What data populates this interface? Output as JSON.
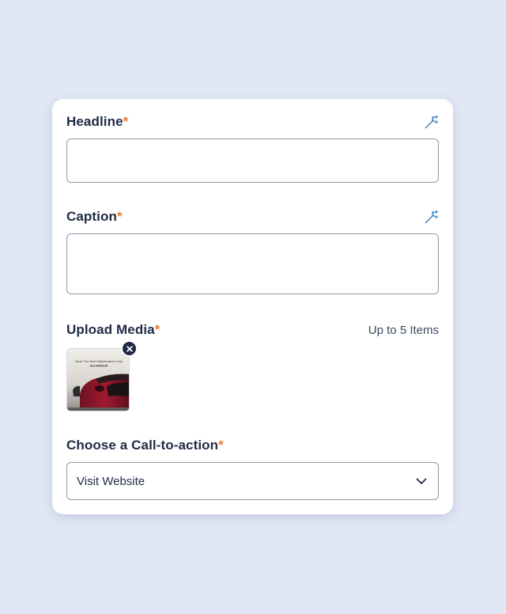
{
  "form": {
    "headline": {
      "label": "Headline",
      "required_mark": "*",
      "value": "",
      "magic_icon": "magic-wand-icon"
    },
    "caption": {
      "label": "Caption",
      "required_mark": "*",
      "value": "",
      "magic_icon": "magic-wand-icon"
    },
    "upload_media": {
      "label": "Upload Media",
      "required_mark": "*",
      "limit_text": "Up to 5 Items",
      "items": [
        {
          "kind": "image",
          "thumb_text_line1": "Book The Best Maintenance Only",
          "thumb_text_line2": "$19.99/HOUR",
          "remove_icon": "close-icon"
        }
      ]
    },
    "cta": {
      "label": "Choose a Call-to-action",
      "required_mark": "*",
      "selected": "Visit Website",
      "chevron_icon": "chevron-down-icon"
    }
  },
  "colors": {
    "page_bg": "#e1e7f5",
    "card_bg": "#ffffff",
    "text": "#1f2a44",
    "required": "#f07a2e",
    "accent_icon": "#3b82c4",
    "border": "#8c98ab"
  }
}
